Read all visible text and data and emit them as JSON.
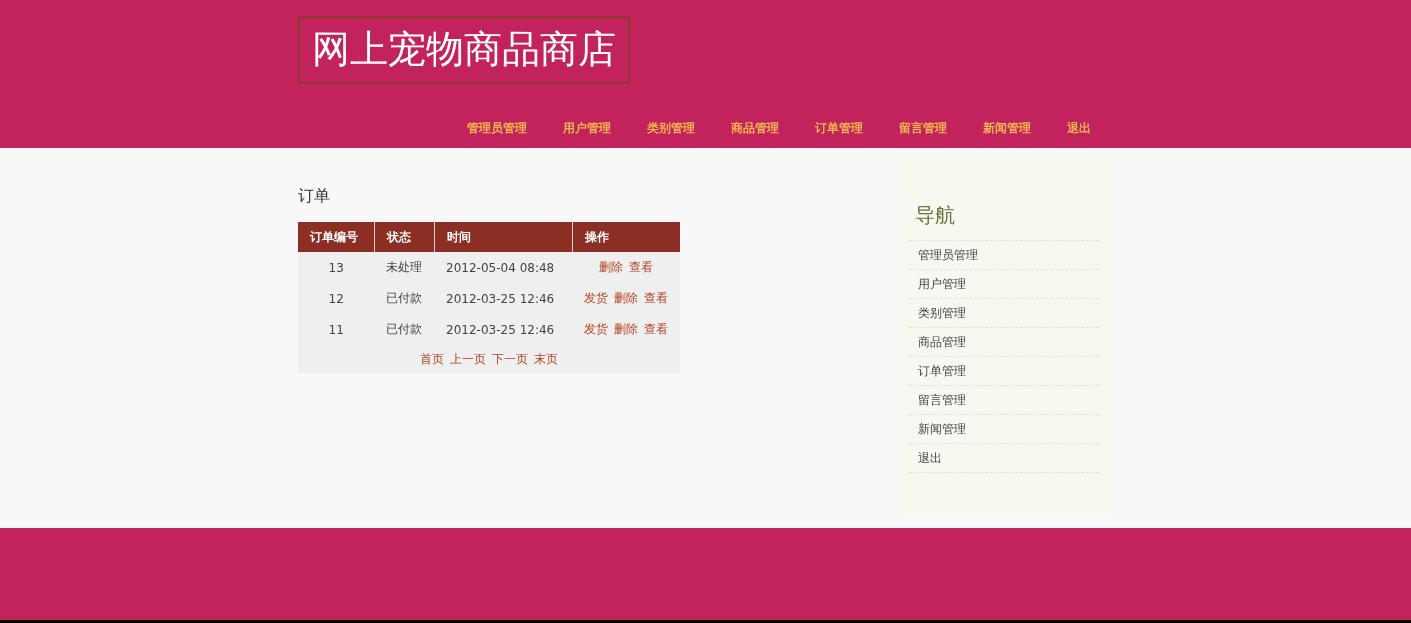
{
  "header": {
    "site_title": "网上宠物商品商店",
    "nav": [
      "管理员管理",
      "用户管理",
      "类别管理",
      "商品管理",
      "订单管理",
      "留言管理",
      "新闻管理",
      "退出"
    ]
  },
  "main": {
    "heading": "订单",
    "table": {
      "columns": [
        "订单编号",
        "状态",
        "时间",
        "操作"
      ],
      "rows": [
        {
          "id": "13",
          "status": "未处理",
          "time": "2012-05-04 08:48",
          "actions": [
            "删除",
            "查看"
          ]
        },
        {
          "id": "12",
          "status": "已付款",
          "time": "2012-03-25 12:46",
          "actions": [
            "发货",
            "删除",
            "查看"
          ]
        },
        {
          "id": "11",
          "status": "已付款",
          "time": "2012-03-25 12:46",
          "actions": [
            "发货",
            "删除",
            "查看"
          ]
        }
      ],
      "pagination": [
        "首页",
        "上一页",
        "下一页",
        "末页"
      ]
    }
  },
  "sidebar": {
    "heading": "导航",
    "items": [
      "管理员管理",
      "用户管理",
      "类别管理",
      "商品管理",
      "订单管理",
      "留言管理",
      "新闻管理",
      "退出"
    ]
  }
}
